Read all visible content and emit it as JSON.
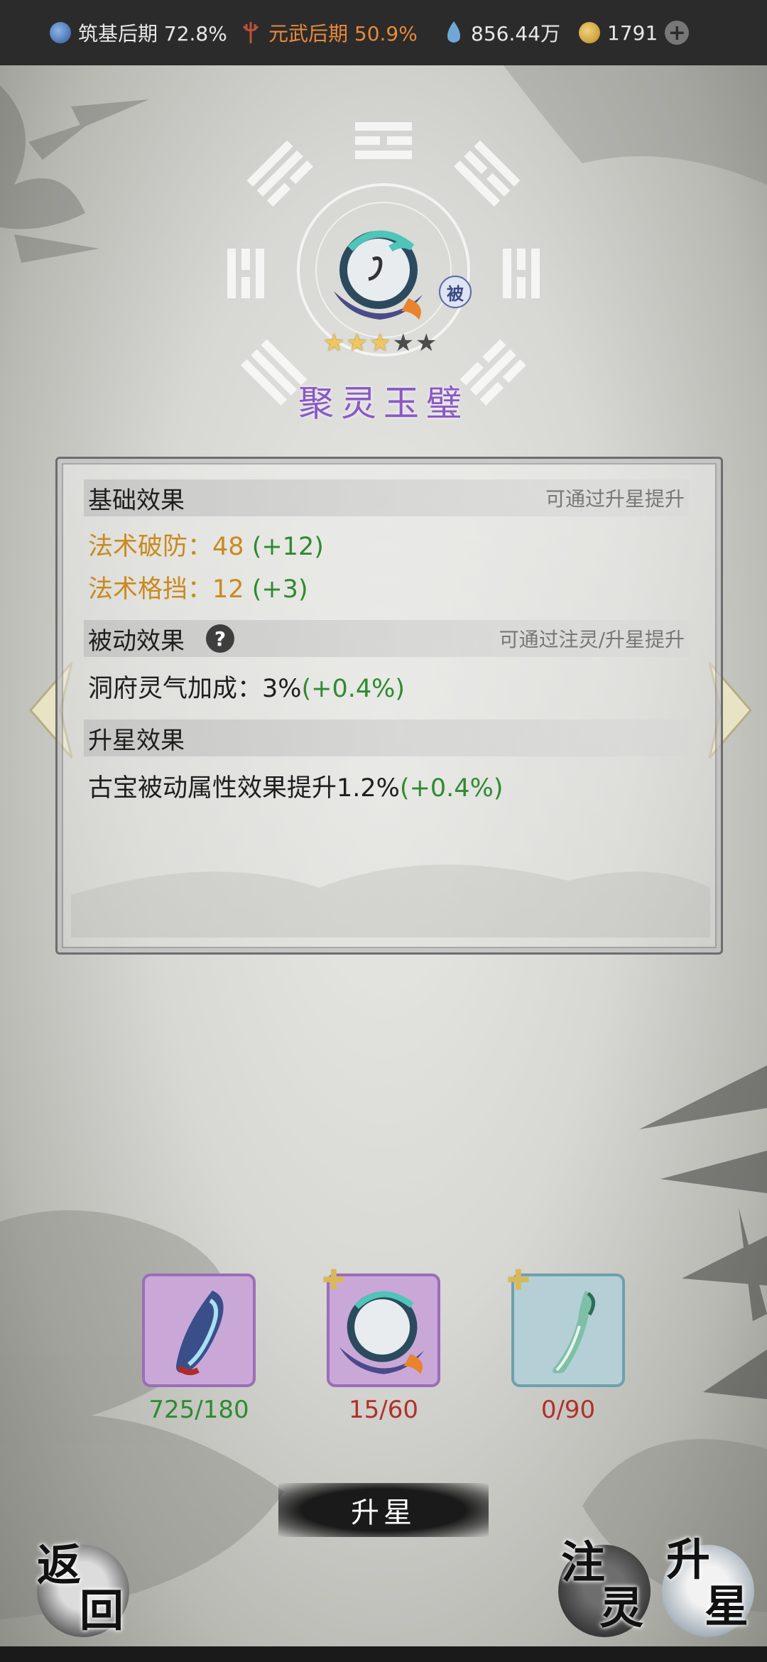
{
  "topbar": {
    "realm1": "筑基后期 72.8%",
    "realm2": "元武后期 50.9%",
    "spirit_stones": "856.44万",
    "jade": "1791",
    "icons": [
      "swirl-orb-icon",
      "red-trident-icon",
      "water-drop-icon",
      "gold-coin-icon",
      "plus-icon"
    ]
  },
  "artifact": {
    "name": "聚灵玉璧",
    "badge": "被",
    "stars_filled": 3,
    "stars_total": 5
  },
  "panel": {
    "basic": {
      "title": "基础效果",
      "hint": "可通过升星提升",
      "stats": [
        {
          "label": "法术破防：",
          "value": "48",
          "bonus": "(+12)"
        },
        {
          "label": "法术格挡：",
          "value": "12",
          "bonus": "(+3)"
        }
      ]
    },
    "passive": {
      "title": "被动效果",
      "hint": "可通过注灵/升星提升",
      "help": "?",
      "text": "洞府灵气加成：3%",
      "bonus": "(+0.4%)"
    },
    "starup": {
      "title": "升星效果",
      "text": "古宝被动属性效果提升1.2%",
      "bonus": "(+0.4%)"
    }
  },
  "materials": [
    {
      "icon": "spirit-jade-shard-icon",
      "count": "725/180"
    },
    {
      "icon": "jade-disc-fragment-icon",
      "count": "15/60"
    },
    {
      "icon": "jade-hook-fragment-icon",
      "count": "0/90"
    }
  ],
  "buttons": {
    "upgrade": "升星",
    "back": [
      "返",
      "回"
    ],
    "infuse": [
      "注",
      "灵"
    ],
    "starup": [
      "升",
      "星"
    ]
  },
  "colors": {
    "name_purple": "#8a58c8",
    "stat_gold": "#c98a1e",
    "bonus_green": "#2f8a2f",
    "count_red": "#b0302a"
  }
}
